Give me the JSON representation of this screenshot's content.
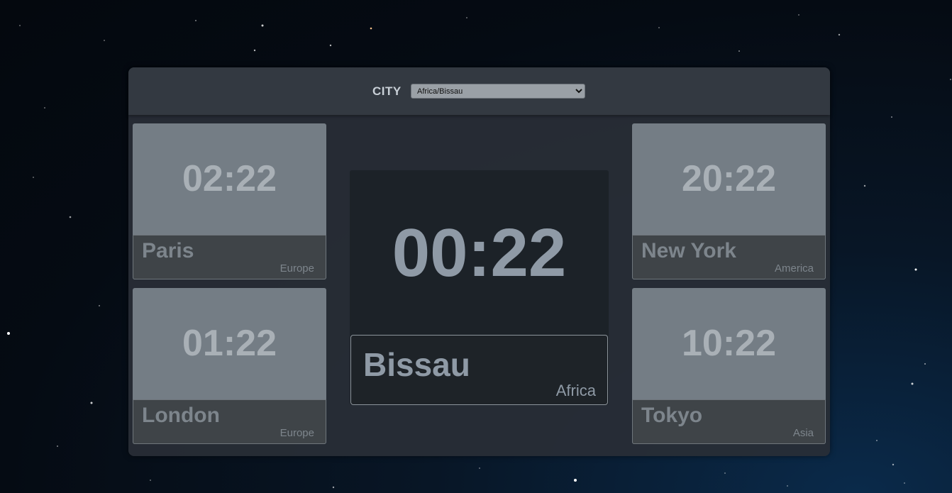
{
  "header": {
    "city_label": "CITY",
    "selected_timezone": "Africa/Bissau"
  },
  "main_clock": {
    "time": "00:22",
    "city": "Bissau",
    "region": "Africa"
  },
  "clocks": [
    {
      "time": "02:22",
      "city": "Paris",
      "region": "Europe"
    },
    {
      "time": "01:22",
      "city": "London",
      "region": "Europe"
    },
    {
      "time": "20:22",
      "city": "New York",
      "region": "America"
    },
    {
      "time": "10:22",
      "city": "Tokyo",
      "region": "Asia"
    }
  ],
  "colors": {
    "panel": "#282e36",
    "card": "#747d85",
    "card_footer": "#3f4448",
    "center": "#1c2228",
    "text_main": "#8f9aa6"
  }
}
